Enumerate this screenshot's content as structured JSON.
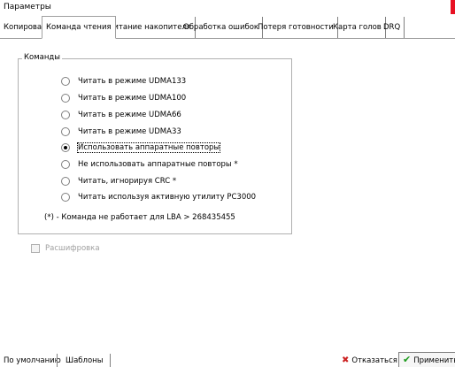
{
  "window": {
    "title": "Параметры"
  },
  "tabs": [
    {
      "label": "Копирование"
    },
    {
      "label": "Команда чтения"
    },
    {
      "label": "Питание накопителя"
    },
    {
      "label": "Обработка ошибок"
    },
    {
      "label": "Потеря готовности"
    },
    {
      "label": "Карта голов"
    },
    {
      "label": "DRQ"
    }
  ],
  "active_tab": "Команда чтения",
  "commands": {
    "group_title": "Команды",
    "options": [
      {
        "label": "Читать в режиме UDMA133",
        "checked": false
      },
      {
        "label": "Читать в режиме UDMA100",
        "checked": false
      },
      {
        "label": "Читать в режиме UDMA66",
        "checked": false
      },
      {
        "label": "Читать в режиме UDMA33",
        "checked": false
      },
      {
        "label": "Использовать аппаратные повторы",
        "checked": true
      },
      {
        "label": "Не использовать аппаратные повторы *",
        "checked": false
      },
      {
        "label": "Читать, игнорируя CRC *",
        "checked": false
      },
      {
        "label": "Читать используя активную утилиту PC3000",
        "checked": false
      }
    ],
    "note": "(*) - Команда не работает для LBA > 268435455"
  },
  "decode": {
    "label": "Расшифровка",
    "checked": false,
    "enabled": false
  },
  "footer": {
    "default_label": "По умолчанию",
    "templates_label": "Шаблоны",
    "cancel_label": "Отказаться",
    "apply_label": "Применить"
  },
  "colors": {
    "cancel_icon": "#cc2222",
    "apply_icon": "#1a9a1a",
    "close_accent": "#e81123"
  }
}
